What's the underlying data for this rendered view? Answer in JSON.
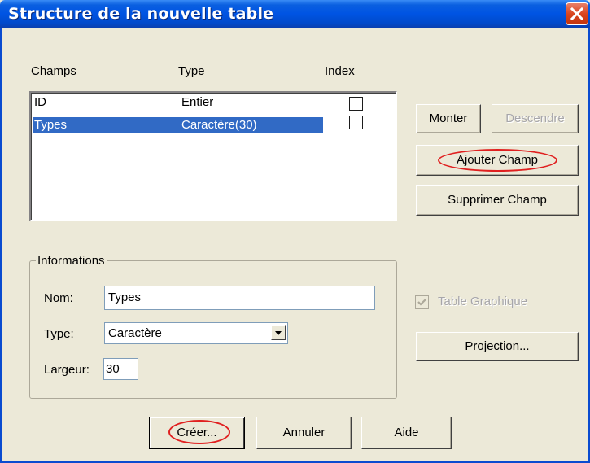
{
  "window": {
    "title": "Structure de la nouvelle table"
  },
  "fields": {
    "headers": {
      "champs": "Champs",
      "type": "Type",
      "index": "Index"
    },
    "rows": [
      {
        "name": "ID",
        "type": "Entier",
        "indexed": false,
        "selected": false
      },
      {
        "name": "Types",
        "type": "Caractère(30)",
        "indexed": false,
        "selected": true
      }
    ]
  },
  "buttons": {
    "monter": "Monter",
    "descendre": "Descendre",
    "ajouter": "Ajouter Champ",
    "supprimer": "Supprimer Champ",
    "projection": "Projection...",
    "creer": "Créer...",
    "annuler": "Annuler",
    "aide": "Aide"
  },
  "info": {
    "group_title": "Informations",
    "nom_label": "Nom:",
    "nom_value": "Types",
    "type_label": "Type:",
    "type_value": "Caractère",
    "largeur_label": "Largeur:",
    "largeur_value": "30"
  },
  "options": {
    "table_graphique_label": "Table Graphique",
    "table_graphique_checked": true
  },
  "colors": {
    "selection": "#316ac5",
    "annotation": "#e02020",
    "titlebar": "#0054e3"
  }
}
